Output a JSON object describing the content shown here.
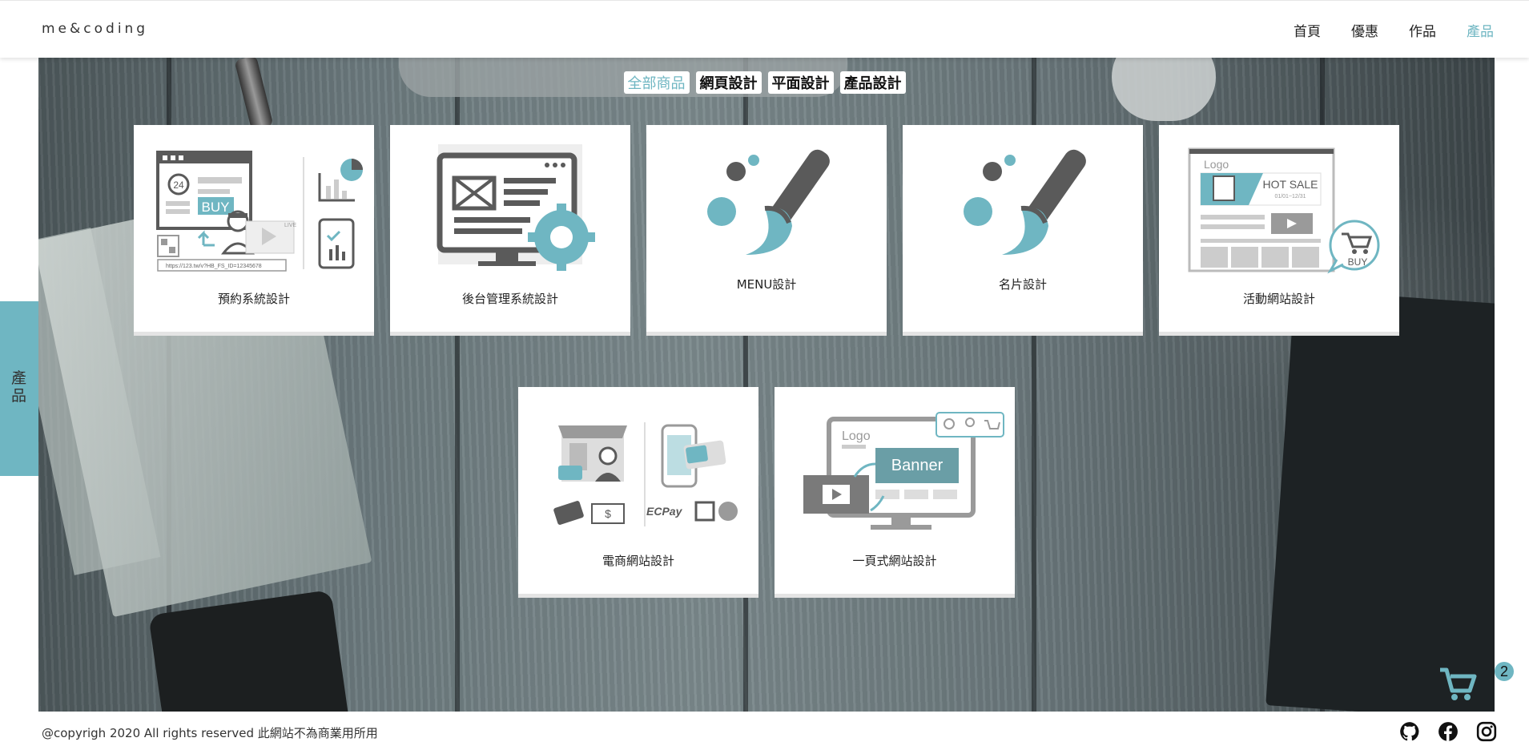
{
  "header": {
    "logo": "me&coding",
    "nav": [
      "首頁",
      "優惠",
      "作品",
      "產品"
    ],
    "active_nav": "產品"
  },
  "filters": [
    "全部商品",
    "網頁設計",
    "平面設計",
    "產品設計"
  ],
  "active_filter": "全部商品",
  "side_tab": "產品",
  "products": [
    {
      "label": "預約系統設計",
      "img_text": [
        "24",
        "BUY",
        "LIVE",
        "https://123.tw/v?HB_FS_ID=12345678"
      ]
    },
    {
      "label": "後台管理系統設計"
    },
    {
      "label": "MENU設計"
    },
    {
      "label": "名片設計"
    },
    {
      "label": "活動網站設計",
      "img_text": [
        "Logo",
        "HOT SALE",
        "01/01~12/31",
        "BUY"
      ]
    },
    {
      "label": "電商網站設計",
      "img_text": [
        "ECPay"
      ]
    },
    {
      "label": "一頁式網站設計",
      "img_text": [
        "Logo",
        "Banner"
      ]
    }
  ],
  "cart": {
    "count": "2",
    "icon": "cart-icon"
  },
  "footer": {
    "copyright": "@copyrigh 2020 All rights reserved 此網站不為商業用所用",
    "social": [
      "github-icon",
      "facebook-icon",
      "instagram-icon"
    ]
  },
  "colors": {
    "accent": "#6fb6c2",
    "icon_gray": "#5a5a5a"
  }
}
